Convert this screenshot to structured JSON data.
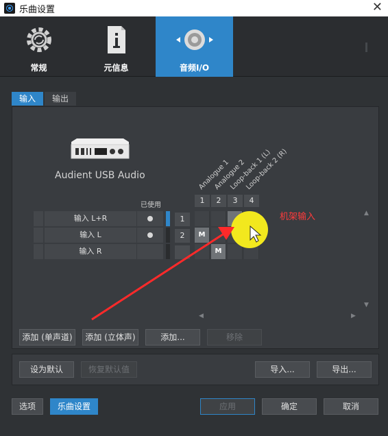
{
  "window": {
    "title": "乐曲设置",
    "close_glyph": "✕"
  },
  "top_tabs": [
    {
      "label": "常规",
      "icon": "gear-refresh-icon"
    },
    {
      "label": "元信息",
      "icon": "info-document-icon"
    },
    {
      "label": "音频I/O",
      "icon": "speaker-icon",
      "active": true
    }
  ],
  "sub_tabs": [
    {
      "label": "输入",
      "active": true
    },
    {
      "label": "输出"
    }
  ],
  "device": {
    "name": "Audient USB Audio"
  },
  "matrix": {
    "used_label": "已使用",
    "columns": [
      {
        "num": "1",
        "name": "Analogue 1"
      },
      {
        "num": "2",
        "name": "Analogue 2"
      },
      {
        "num": "3",
        "name": "Loop-back 1 (L)"
      },
      {
        "num": "4",
        "name": "Loop-back 2 (R)"
      }
    ],
    "rows": [
      {
        "name": "输入 L+R",
        "channel": "1",
        "used": true
      },
      {
        "name": "输入 L",
        "channel": "2",
        "used": true,
        "marker": "M"
      },
      {
        "name": "输入 R",
        "channel": "",
        "used": false,
        "marker": "M"
      }
    ]
  },
  "annotation": {
    "text": "机架输入"
  },
  "buttons": {
    "add_mono": "添加 (单声道)",
    "add_stereo": "添加 (立体声)",
    "add_more": "添加...",
    "remove": "移除",
    "set_default": "设为默认",
    "restore_default": "恢复默认值",
    "import": "导入...",
    "export": "导出...",
    "options": "选项",
    "song_settings": "乐曲设置",
    "apply": "应用",
    "ok": "确定",
    "cancel": "取消"
  },
  "colors": {
    "accent": "#2f86c9",
    "annotation": "#ff3b3b",
    "cursor_highlight": "#f2e81e"
  }
}
